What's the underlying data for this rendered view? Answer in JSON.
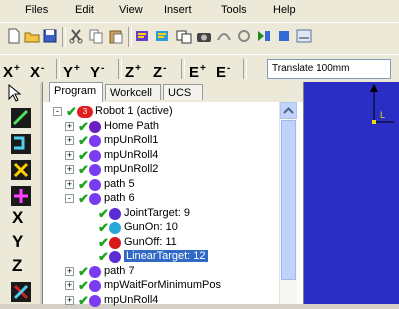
{
  "menu": [
    "Files",
    "Edit",
    "View",
    "Insert",
    "Tools",
    "Help"
  ],
  "toolbar2": {
    "axes": [
      "X",
      "X",
      "Y",
      "Y",
      "Z",
      "Z",
      "E",
      "E"
    ],
    "signs": [
      "+",
      "-",
      "+",
      "-",
      "+",
      "-",
      "+",
      "-"
    ],
    "translate_value": "Translate 100mm"
  },
  "jog_letters": [
    "X",
    "Y",
    "Z"
  ],
  "tabs": [
    "Program",
    "Workcell",
    "UCS"
  ],
  "tree": [
    {
      "label": "Robot 1 (active)",
      "icon_color": "#e02020",
      "icon_text": "3",
      "depth": 0,
      "expander": "-"
    },
    {
      "label": "Home Path",
      "icon_color": "#6a1fc4",
      "depth": 1,
      "expander": "+"
    },
    {
      "label": "mpUnRoll1",
      "icon_color": "#7a3cf0",
      "depth": 1,
      "expander": "+"
    },
    {
      "label": "mpUnRoll4",
      "icon_color": "#7a3cf0",
      "depth": 1,
      "expander": "+"
    },
    {
      "label": "mpUnRoll2",
      "icon_color": "#7a3cf0",
      "depth": 1,
      "expander": "+"
    },
    {
      "label": "path 5",
      "icon_color": "#7a3cf0",
      "depth": 1,
      "expander": "+"
    },
    {
      "label": "path 6",
      "icon_color": "#7a3cf0",
      "depth": 1,
      "expander": "-"
    },
    {
      "label": "JointTarget: 9",
      "icon_color": "#5b2bd6",
      "depth": 2,
      "expander": ""
    },
    {
      "label": "GunOn: 10",
      "icon_color": "#2aa7d8",
      "depth": 2,
      "expander": ""
    },
    {
      "label": "GunOff: 11",
      "icon_color": "#d81818",
      "depth": 2,
      "expander": ""
    },
    {
      "label": "LinearTarget: 12",
      "icon_color": "#5b2bd6",
      "depth": 2,
      "expander": "",
      "selected": true
    },
    {
      "label": "path 7",
      "icon_color": "#7a3cf0",
      "depth": 1,
      "expander": "+"
    },
    {
      "label": "mpWaitForMinimumPos",
      "icon_color": "#7a3cf0",
      "depth": 1,
      "expander": "+"
    },
    {
      "label": "mpUnRoll4",
      "icon_color": "#7a3cf0",
      "depth": 1,
      "expander": "+"
    }
  ]
}
